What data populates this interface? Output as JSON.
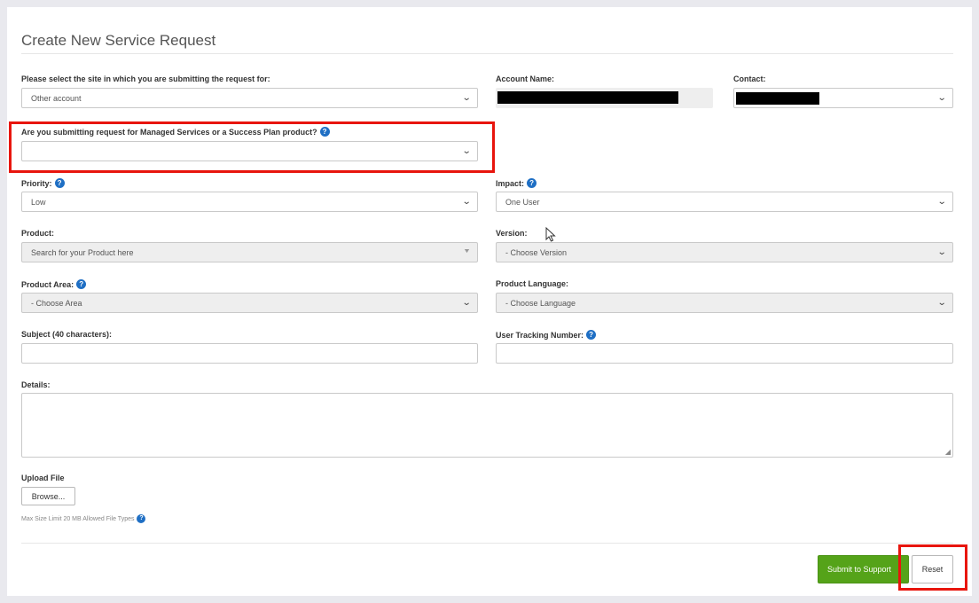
{
  "form": {
    "title": "Create New Service Request",
    "site": {
      "label": "Please select the site in which you are submitting the request for:",
      "value": "Other account"
    },
    "account_name": {
      "label": "Account Name:"
    },
    "contact": {
      "label": "Contact:"
    },
    "managed_services": {
      "label": "Are you submitting request for Managed Services or a Success Plan product?",
      "value": ""
    },
    "priority": {
      "label": "Priority:",
      "value": "Low"
    },
    "impact": {
      "label": "Impact:",
      "value": "One User"
    },
    "product": {
      "label": "Product:",
      "placeholder": "Search for your Product here"
    },
    "version": {
      "label": "Version:",
      "value": "- Choose Version"
    },
    "product_area": {
      "label": "Product Area:",
      "value": "- Choose Area"
    },
    "product_language": {
      "label": "Product Language:",
      "value": "- Choose Language"
    },
    "subject": {
      "label": "Subject (40 characters):",
      "value": ""
    },
    "user_tracking": {
      "label": "User Tracking Number:",
      "value": ""
    },
    "details": {
      "label": "Details:",
      "value": ""
    },
    "upload": {
      "label": "Upload File",
      "browse_label": "Browse...",
      "hint": "Max Size Limit 20 MB Allowed File Types"
    }
  },
  "actions": {
    "submit_label": "Submit to Support",
    "reset_label": "Reset"
  },
  "icons": {
    "help": "question-circle-icon",
    "chevron": "chevron-down-icon",
    "cursor": "mouse-pointer-icon"
  },
  "colors": {
    "help_icon": "#1f6fc4",
    "submit_button": "#55a319",
    "highlight": "#e8150d"
  }
}
